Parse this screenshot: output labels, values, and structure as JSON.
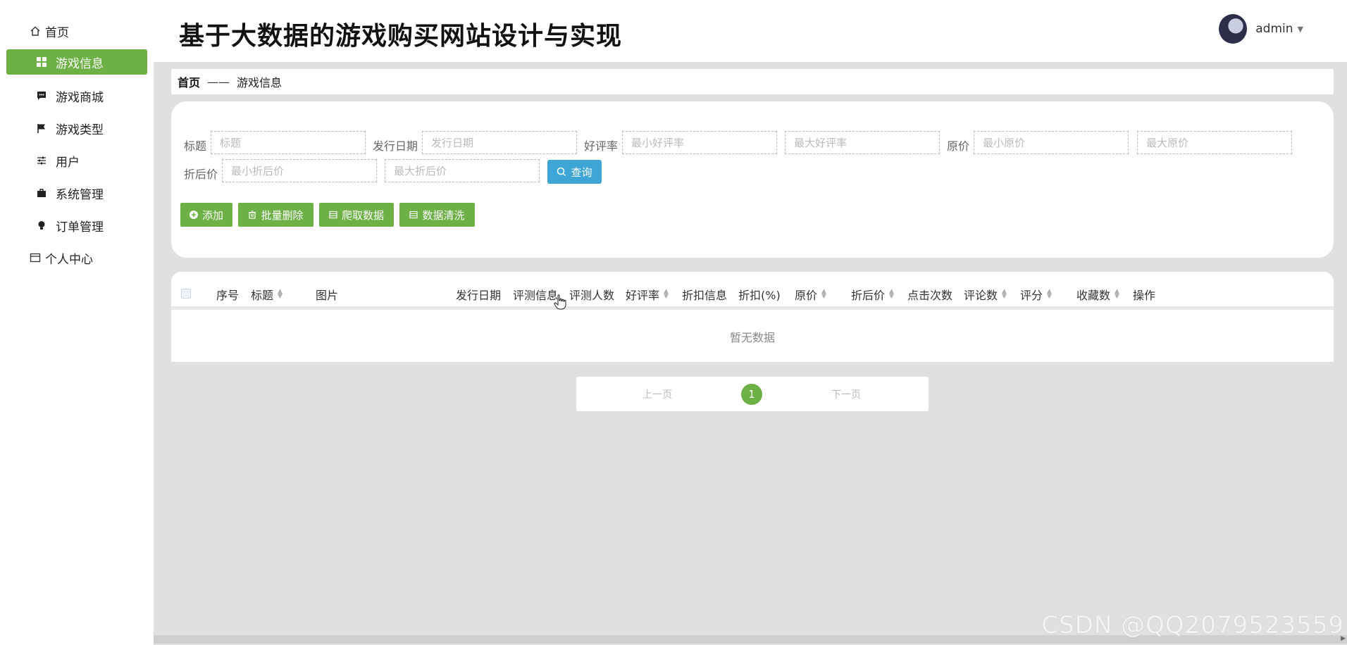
{
  "header": {
    "title": "基于大数据的游戏购买网站设计与实现",
    "username": "admin"
  },
  "sidebar": {
    "items": [
      {
        "label": "首页",
        "icon": "home-icon"
      },
      {
        "label": "游戏信息",
        "icon": "grid-icon",
        "active": true
      },
      {
        "label": "游戏商城",
        "icon": "chat-icon"
      },
      {
        "label": "游戏类型",
        "icon": "flag-icon"
      },
      {
        "label": "用户",
        "icon": "sliders-icon"
      },
      {
        "label": "系统管理",
        "icon": "briefcase-icon"
      },
      {
        "label": "订单管理",
        "icon": "bulb-icon"
      },
      {
        "label": "个人中心",
        "icon": "card-icon"
      }
    ]
  },
  "breadcrumb": {
    "home": "首页",
    "separator": "——",
    "current": "游戏信息"
  },
  "search": {
    "fields": [
      {
        "label": "标题",
        "placeholders": [
          "标题"
        ]
      },
      {
        "label": "发行日期",
        "placeholders": [
          "发行日期"
        ]
      },
      {
        "label": "好评率",
        "placeholders": [
          "最小好评率",
          "最大好评率"
        ]
      },
      {
        "label": "原价",
        "placeholders": [
          "最小原价",
          "最大原价"
        ]
      },
      {
        "label": "折后价",
        "placeholders": [
          "最小折后价",
          "最大折后价"
        ]
      }
    ],
    "query_button": "查询"
  },
  "actions": {
    "add": "添加",
    "batch_delete": "批量删除",
    "crawl": "爬取数据",
    "clean": "数据清洗"
  },
  "table": {
    "columns": [
      {
        "label": "序号",
        "sortable": false
      },
      {
        "label": "标题",
        "sortable": true
      },
      {
        "label": "图片",
        "sortable": false
      },
      {
        "label": "发行日期",
        "sortable": false
      },
      {
        "label": "评测信息",
        "sortable": false
      },
      {
        "label": "评测人数",
        "sortable": false
      },
      {
        "label": "好评率",
        "sortable": true
      },
      {
        "label": "折扣信息",
        "sortable": false
      },
      {
        "label": "折扣(%)",
        "sortable": false
      },
      {
        "label": "原价",
        "sortable": true
      },
      {
        "label": "折后价",
        "sortable": true
      },
      {
        "label": "点击次数",
        "sortable": false
      },
      {
        "label": "评论数",
        "sortable": true
      },
      {
        "label": "评分",
        "sortable": true
      },
      {
        "label": "收藏数",
        "sortable": true
      },
      {
        "label": "操作",
        "sortable": false
      }
    ],
    "empty_text": "暂无数据"
  },
  "pagination": {
    "prev": "上一页",
    "current": "1",
    "next": "下一页"
  },
  "watermark": "CSDN @QQ2079523559",
  "colors": {
    "accent": "#6db046",
    "query": "#3ea6d6"
  }
}
